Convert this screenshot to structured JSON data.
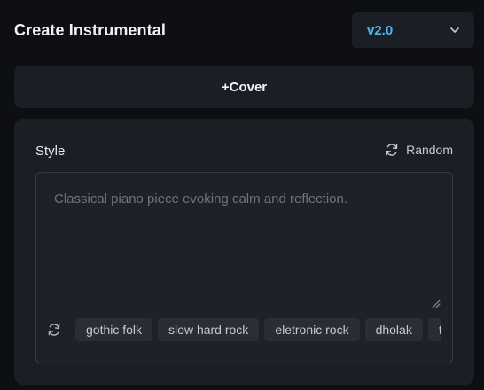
{
  "header": {
    "title": "Create Instrumental",
    "version_select": {
      "value": "v2.0",
      "icon": "chevron-down-icon"
    }
  },
  "cover_button": {
    "label": "+Cover"
  },
  "style_panel": {
    "label": "Style",
    "random_button": {
      "label": "Random",
      "icon": "refresh-icon"
    },
    "textarea": {
      "placeholder": "Classical piano piece evoking calm and reflection.",
      "value": ""
    },
    "tags": [
      "gothic folk",
      "slow hard rock",
      "eletronic rock",
      "dholak",
      "tra"
    ]
  },
  "colors": {
    "background": "#0e0f13",
    "surface": "#1c1e25",
    "accent": "#49b7ea",
    "tag_bg": "#2a2d35",
    "placeholder_text": "#6f737d"
  }
}
